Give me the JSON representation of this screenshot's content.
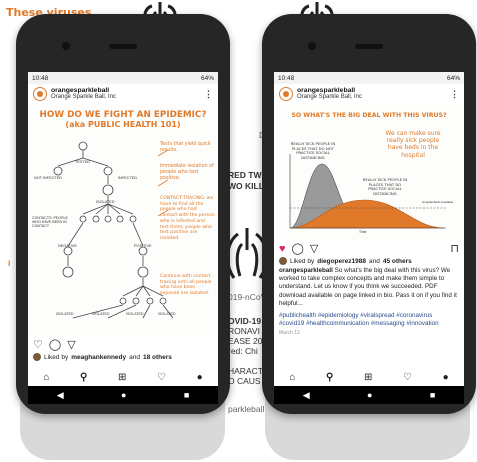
{
  "background": {
    "title": "These viruses",
    "fragments": [
      "RED TWO",
      "WO KILL",
      "D",
      "i",
      "019-nCoV",
      "OVID-19",
      "RONAVI",
      "EASE 20",
      "red: Chi",
      "HARACT",
      "O CAUS",
      "parkleball"
    ]
  },
  "left_phone": {
    "status": {
      "time": "10:48",
      "right": "64%"
    },
    "account": {
      "username": "orangesparkleball",
      "subtitle": "Orange Sparkle Ball, Inc"
    },
    "post": {
      "title": "HOW DO WE FIGHT AN EPIDEMIC?",
      "subtitle": "(aka PUBLIC HEALTH 101)",
      "notes": [
        "Tests that yield quick results.",
        "Immediate isolation of people who test positive.",
        "CONTACT TRACING: we have to find all the people who had contact with the person who is infected and test them; people who test positive are isolated.",
        "Continue with contact tracing until all people who have been exposed are isolated."
      ],
      "labels": [
        "TESTED",
        "NOT INFECTED",
        "INFECTED",
        "ISOLATED",
        "CONTACTS: PEOPLE WHO HAVE BEEN IN CONTACT",
        "NEGATIVE",
        "POSITIVE",
        "ISOLATED",
        "ISOLATED",
        "ISOLATED",
        "ISOLATED"
      ]
    },
    "liked": {
      "prefix": "Liked by",
      "user": "meaghankennedy",
      "and": "and",
      "others": "18 others"
    }
  },
  "right_phone": {
    "status": {
      "time": "10:48",
      "right": "64%"
    },
    "account": {
      "username": "orangesparkleball",
      "subtitle": "Orange Sparkle Ball, Inc"
    },
    "post": {
      "title": "SO WHAT'S THE BIG DEAL WITH THIS VIRUS?",
      "note_right": "We can make sure really sick people have beds in the hospital",
      "note_left": "REALLY SICK PEOPLE IN PLACES THAT DO NOT PRACTICE SOCIAL DISTANCING",
      "note_mid": "REALLY SICK PEOPLE IN PLACES THAT DO PRACTICE SOCIAL DISTANCING",
      "beds_label": "Hospital Beds Available",
      "x_label": "Time"
    },
    "liked": {
      "prefix": "Liked by",
      "user": "diegoperez1988",
      "and": "and",
      "others": "45 others"
    },
    "caption_user": "orangesparkleball",
    "caption": "So what's the big deal with this virus? We worked to take complex concepts and make them simple to understand. Let us know if you think we succeeded. PDF download available on page linked in bio. Pass it on if you find it helpful...",
    "tags": "#publichealth #epidemiology #viralspread #coronavirus #covid19 #healthcommunication #messaging #innovation",
    "date": "March 13"
  },
  "icons": {
    "more": "kebab-icon",
    "heart": "heart-icon",
    "comment": "comment-icon",
    "share": "send-icon",
    "save": "bookmark-icon",
    "home": "home-icon",
    "search": "search-icon",
    "add": "add-post-icon",
    "activity": "heart-outline-icon",
    "profile": "profile-icon",
    "back": "back-triangle-icon",
    "home_nav": "home-circle-icon",
    "recents": "recents-square-icon"
  },
  "colors": {
    "accent": "#e07a2a",
    "phone": "#262626",
    "heart_active": "#e0245e",
    "hashtag": "#2b4c8c"
  }
}
